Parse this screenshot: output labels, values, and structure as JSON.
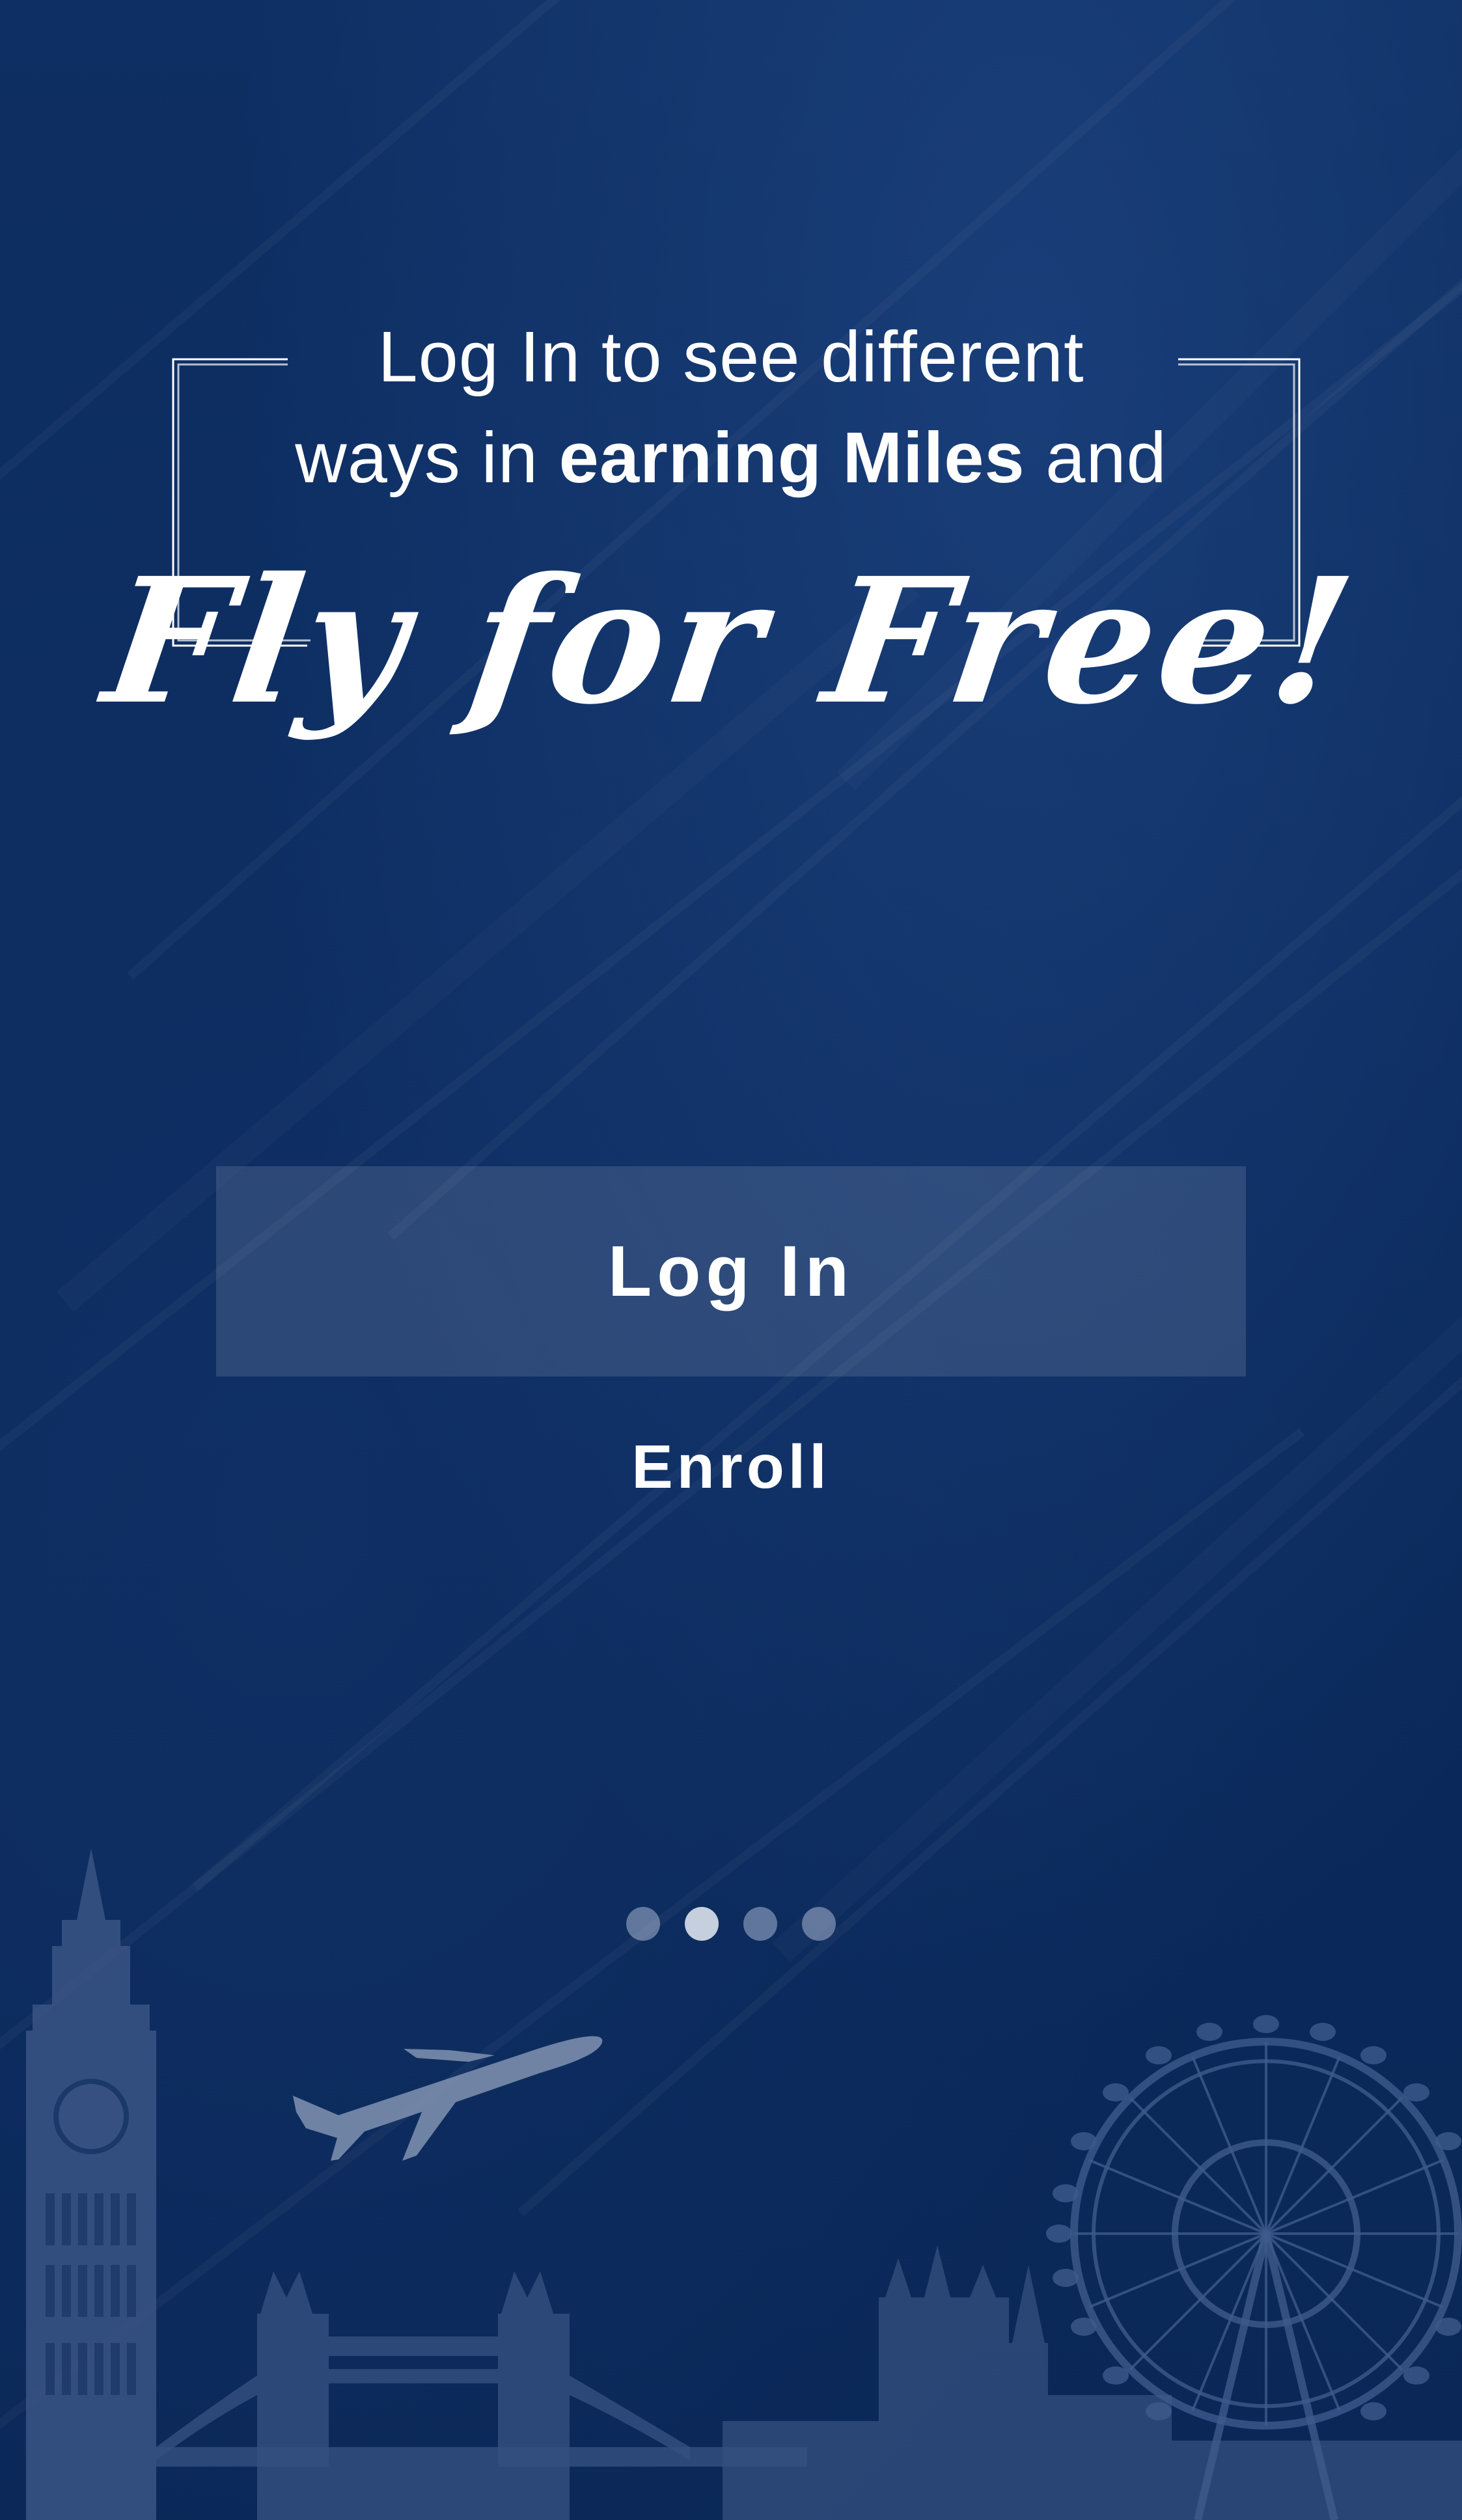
{
  "headline": {
    "line1": "Log In to see different",
    "line2_prefix": "ways in ",
    "line2_bold": "earning Miles",
    "line2_suffix": " and",
    "script": "Fly for Free!"
  },
  "buttons": {
    "login_label": "Log In",
    "enroll_label": "Enroll"
  },
  "pager": {
    "count": 4,
    "active_index": 1
  },
  "colors": {
    "background": "#0b2a5c",
    "button_fill": "rgba(255,255,255,0.12)",
    "text": "#ffffff",
    "skyline": "#3a5585"
  },
  "icons": {
    "skyline": "london-skyline-icon",
    "airplane": "airplane-icon",
    "clock_tower": "big-ben-icon",
    "ferris_wheel": "london-eye-icon",
    "bridge": "tower-bridge-icon"
  }
}
